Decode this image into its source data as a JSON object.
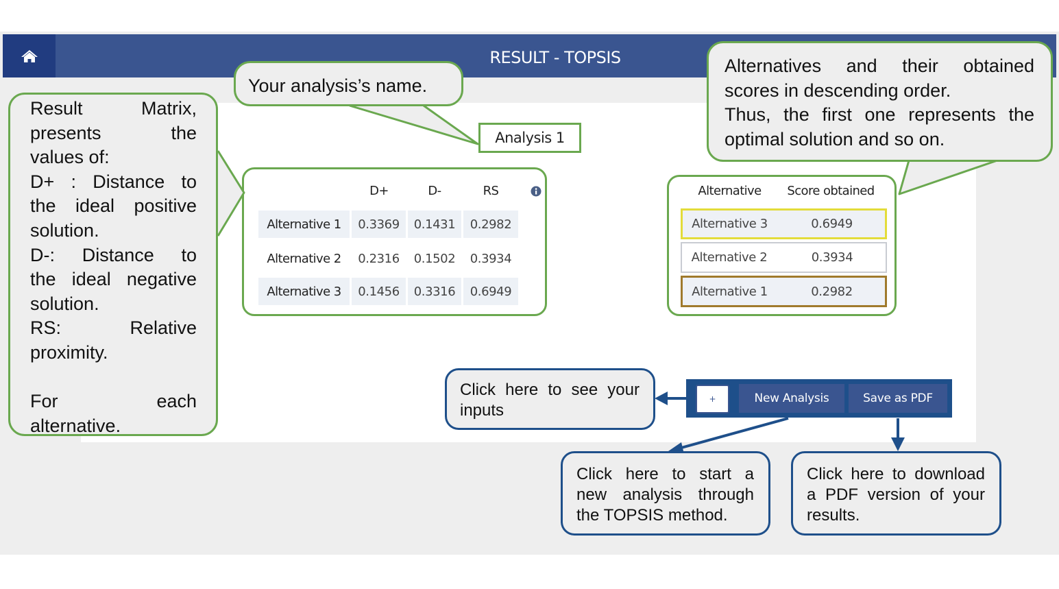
{
  "navbar": {
    "title": "RESULT - TOPSIS",
    "home_icon": "home-icon"
  },
  "analysis": {
    "name": "Analysis 1"
  },
  "matrix": {
    "headers": [
      "D+",
      "D-",
      "RS"
    ],
    "info_icon": "info-icon",
    "rows": [
      {
        "label": "Alternative 1",
        "dplus": "0.3369",
        "dminus": "0.1431",
        "rs": "0.2982"
      },
      {
        "label": "Alternative 2",
        "dplus": "0.2316",
        "dminus": "0.1502",
        "rs": "0.3934"
      },
      {
        "label": "Alternative 3",
        "dplus": "0.1456",
        "dminus": "0.3316",
        "rs": "0.6949"
      }
    ]
  },
  "ranking": {
    "headers": [
      "Alternative",
      "Score obtained"
    ],
    "rows": [
      {
        "alternative": "Alternative 3",
        "score": "0.6949"
      },
      {
        "alternative": "Alternative 2",
        "score": "0.3934"
      },
      {
        "alternative": "Alternative 1",
        "score": "0.2982"
      }
    ],
    "row_border_colors": [
      "#e3dc3a",
      "#c9ccd2",
      "#a07a2c"
    ]
  },
  "buttons": {
    "inputs_label": "+",
    "new_analysis": "New Analysis",
    "save_pdf": "Save as PDF"
  },
  "callouts": {
    "analysis_name": "Your analysis’s name.",
    "matrix_lines": [
      "Result Matrix,",
      "presents the",
      "values of:",
      "D+ : Distance to",
      "the ideal positive",
      "solution.",
      "D-: Distance to",
      "the ideal negative",
      "solution.",
      "RS: Relative",
      "proximity.",
      "",
      "For each",
      "alternative."
    ],
    "ranking_lines": [
      "Alternatives and their obtained",
      "scores in descending order.",
      "Thus, the first one represents the",
      "optimal solution and so on."
    ],
    "inputs_lines": [
      "Click here to see your",
      "inputs"
    ],
    "new_analysis_lines": [
      "Click here to start a",
      "new analysis through",
      "the TOPSIS method."
    ],
    "pdf_lines": [
      "Click here to download",
      "a PDF version of your",
      "results."
    ]
  },
  "colors": {
    "nav": "#3a5590",
    "home": "#213c80",
    "green": "#6aa84f",
    "blue": "#1e4f8a"
  }
}
